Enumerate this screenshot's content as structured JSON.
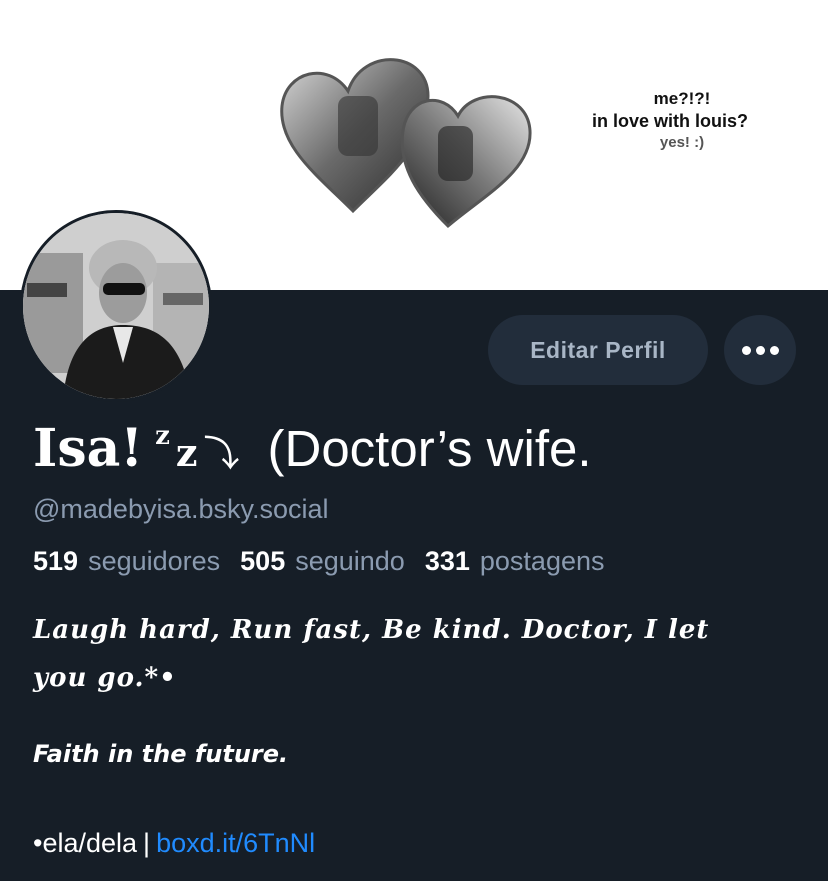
{
  "banner": {
    "caption_line1": "me?!?!",
    "caption_line2": "in love with louis?",
    "caption_line3": "yes! :)"
  },
  "buttons": {
    "edit_profile": "Editar Perfil",
    "more_icon": "ellipsis-icon"
  },
  "profile": {
    "name_part1": "Isa!",
    "name_sup": "z",
    "name_z": "z",
    "name_arrow": "⤵",
    "name_rest": "(Doctor’s wife.",
    "handle": "@madebyisa.bsky.social"
  },
  "stats": {
    "followers_count": "519",
    "followers_label": "seguidores",
    "following_count": "505",
    "following_label": "seguindo",
    "posts_count": "331",
    "posts_label": "postagens"
  },
  "bio": {
    "line1": "Laugh hard, Run fast, Be kind. Doctor, I let you go.*•",
    "line2": "Faith in the future.",
    "pronouns": "•ela/dela",
    "separator": "|",
    "link": "boxd.it/6TnNl"
  },
  "colors": {
    "background": "#161e27",
    "button_bg": "#222d3b",
    "muted_text": "#8b9bb0",
    "link": "#208bfe"
  }
}
